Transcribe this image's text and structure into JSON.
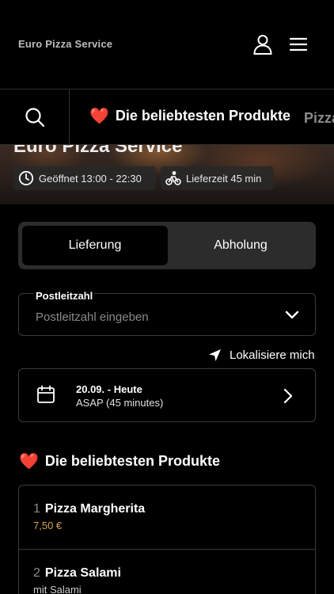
{
  "header": {
    "brand": "Euro Pizza Service",
    "icons": {
      "user": "user-icon",
      "menu": "hamburger-menu-icon"
    }
  },
  "categories": {
    "search_icon": "search-icon",
    "active": {
      "emoji": "❤️",
      "label": "Die beliebtesten Produkte"
    },
    "next_label": "Pizza"
  },
  "hero": {
    "title": "Euro Pizza Service",
    "opening": "Geöffnet 13:00 - 22:30",
    "delivery_time": "Lieferzeit 45 min"
  },
  "order_mode": {
    "options": [
      "Lieferung",
      "Abholung"
    ],
    "selected": "Lieferung"
  },
  "postal": {
    "label": "Postleitzahl",
    "placeholder": "Postleitzahl eingeben"
  },
  "locate": {
    "label": "Lokalisiere mich"
  },
  "schedule": {
    "date": "20.09. - Heute",
    "time": "ASAP (45 minutes)"
  },
  "popular": {
    "emoji": "❤️",
    "title": "Die beliebtesten Produkte",
    "items": [
      {
        "rank": "1",
        "name": "Pizza Margherita",
        "sub": "7,50 €"
      },
      {
        "rank": "2",
        "name": "Pizza Salami",
        "sub": "mit Salami"
      }
    ]
  },
  "colors": {
    "background": "#000000",
    "price": "#d4a24e",
    "border": "#3a3a3a",
    "toggle_bg": "#2c2c2c"
  }
}
